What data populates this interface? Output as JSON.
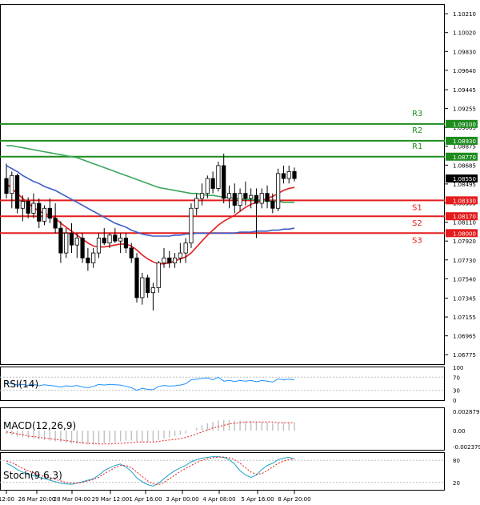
{
  "chart_data": {
    "type": "candlestick",
    "instrument_note": "",
    "price_axis": {
      "ticks": [
        "1.10210",
        "1.10020",
        "1.09830",
        "1.09640",
        "1.09445",
        "1.09255",
        "1.09065",
        "1.08875",
        "1.08685",
        "1.08495",
        "1.08305",
        "1.08110",
        "1.07920",
        "1.07730",
        "1.07540",
        "1.07345",
        "1.07155",
        "1.06965",
        "1.06775"
      ]
    },
    "price_range": [
      1.0668,
      1.103
    ],
    "time_axis": {
      "labels": [
        "12:00",
        "26 Mar 20:00",
        "28 Mar 04:00",
        "29 Mar 12:00",
        "1 Apr 16:00",
        "3 Apr 00:00",
        "4 Apr 08:00",
        "5 Apr 16:00",
        "8 Apr 20:00"
      ]
    },
    "current_price": "1.08550",
    "levels": [
      {
        "name": "R3",
        "value": 1.091,
        "label": "1.09100",
        "color": "#1e8c1e"
      },
      {
        "name": "R2",
        "value": 1.0893,
        "label": "1.08930",
        "color": "#1e8c1e"
      },
      {
        "name": "R1",
        "value": 1.0877,
        "label": "1.08770",
        "color": "#1e8c1e"
      },
      {
        "name": "S1",
        "value": 1.0833,
        "label": "1.08330",
        "color": "#e41c1c"
      },
      {
        "name": "S2",
        "value": 1.0817,
        "label": "1.08170",
        "color": "#e41c1c"
      },
      {
        "name": "S3",
        "value": 1.08,
        "label": "1.08000",
        "color": "#e41c1c"
      }
    ],
    "candles": [
      [
        1.0855,
        1.087,
        1.0835,
        1.084
      ],
      [
        1.084,
        1.0862,
        1.0825,
        1.0858
      ],
      [
        1.0858,
        1.086,
        1.082,
        1.0825
      ],
      [
        1.0825,
        1.0838,
        1.0812,
        1.0832
      ],
      [
        1.0832,
        1.0836,
        1.0815,
        1.082
      ],
      [
        1.082,
        1.084,
        1.0815,
        1.083
      ],
      [
        1.083,
        1.0835,
        1.0805,
        1.0812
      ],
      [
        1.0812,
        1.0828,
        1.0808,
        1.0825
      ],
      [
        1.0825,
        1.0835,
        1.081,
        1.0815
      ],
      [
        1.0815,
        1.083,
        1.08,
        1.0805
      ],
      [
        1.0805,
        1.0812,
        1.077,
        1.078
      ],
      [
        1.078,
        1.0805,
        1.0775,
        1.08
      ],
      [
        1.08,
        1.081,
        1.078,
        1.0788
      ],
      [
        1.0788,
        1.08,
        1.0775,
        1.0795
      ],
      [
        1.0795,
        1.08,
        1.077,
        1.0775
      ],
      [
        1.0775,
        1.0785,
        1.0762,
        1.077
      ],
      [
        1.077,
        1.0785,
        1.0765,
        1.078
      ],
      [
        1.078,
        1.08,
        1.0775,
        1.0795
      ],
      [
        1.0795,
        1.0805,
        1.0788,
        1.079
      ],
      [
        1.079,
        1.08,
        1.0785,
        1.0798
      ],
      [
        1.0798,
        1.0805,
        1.079,
        1.0792
      ],
      [
        1.0792,
        1.08,
        1.078,
        1.0795
      ],
      [
        1.0795,
        1.08,
        1.078,
        1.0785
      ],
      [
        1.0785,
        1.079,
        1.077,
        1.0775
      ],
      [
        1.0775,
        1.078,
        1.073,
        1.0735
      ],
      [
        1.0735,
        1.076,
        1.0728,
        1.0755
      ],
      [
        1.0755,
        1.0758,
        1.0735,
        1.074
      ],
      [
        1.074,
        1.075,
        1.0722,
        1.0745
      ],
      [
        1.0745,
        1.0772,
        1.074,
        1.077
      ],
      [
        1.077,
        1.0785,
        1.0765,
        1.0775
      ],
      [
        1.0775,
        1.0782,
        1.0765,
        1.077
      ],
      [
        1.077,
        1.078,
        1.0765,
        1.0775
      ],
      [
        1.0775,
        1.079,
        1.077,
        1.078
      ],
      [
        1.078,
        1.0795,
        1.077,
        1.079
      ],
      [
        1.079,
        1.083,
        1.0785,
        1.0825
      ],
      [
        1.0825,
        1.084,
        1.0818,
        1.0835
      ],
      [
        1.0835,
        1.085,
        1.0828,
        1.084
      ],
      [
        1.084,
        1.0858,
        1.0835,
        1.0855
      ],
      [
        1.0855,
        1.0862,
        1.084,
        1.0845
      ],
      [
        1.0845,
        1.0872,
        1.0842,
        1.0868
      ],
      [
        1.0868,
        1.088,
        1.083,
        1.0835
      ],
      [
        1.0835,
        1.0848,
        1.0825,
        1.084
      ],
      [
        1.084,
        1.085,
        1.082,
        1.0828
      ],
      [
        1.0828,
        1.0845,
        1.0822,
        1.084
      ],
      [
        1.084,
        1.0852,
        1.0828,
        1.0835
      ],
      [
        1.0835,
        1.0845,
        1.0825,
        1.0838
      ],
      [
        1.0838,
        1.0845,
        1.0795,
        1.083
      ],
      [
        1.083,
        1.0845,
        1.0825,
        1.084
      ],
      [
        1.084,
        1.0848,
        1.0825,
        1.0832
      ],
      [
        1.0832,
        1.084,
        1.082,
        1.0825
      ],
      [
        1.0825,
        1.0865,
        1.0822,
        1.086
      ],
      [
        1.086,
        1.0868,
        1.085,
        1.0855
      ],
      [
        1.0855,
        1.0868,
        1.085,
        1.0862
      ],
      [
        1.0862,
        1.0866,
        1.0852,
        1.0855
      ]
    ],
    "ma_red": [
      1.085,
      1.0845,
      1.084,
      1.0835,
      1.083,
      1.0826,
      1.0822,
      1.082,
      1.0818,
      1.0815,
      1.081,
      1.0806,
      1.0802,
      1.0798,
      1.0794,
      1.079,
      1.0787,
      1.0786,
      1.0786,
      1.0787,
      1.0788,
      1.0789,
      1.0789,
      1.0787,
      1.0783,
      1.0778,
      1.0774,
      1.0771,
      1.0769,
      1.0769,
      1.077,
      1.0772,
      1.0774,
      1.0776,
      1.078,
      1.0786,
      1.0792,
      1.0798,
      1.0803,
      1.0808,
      1.0812,
      1.0815,
      1.0818,
      1.0822,
      1.0826,
      1.0829,
      1.0831,
      1.0833,
      1.0835,
      1.0837,
      1.084,
      1.0843,
      1.0845,
      1.0846
    ],
    "ma_blue": [
      1.0868,
      1.0865,
      1.0862,
      1.0858,
      1.0855,
      1.0852,
      1.085,
      1.0847,
      1.0845,
      1.0843,
      1.084,
      1.0837,
      1.0834,
      1.0831,
      1.0828,
      1.0825,
      1.0822,
      1.0819,
      1.0816,
      1.0813,
      1.081,
      1.0808,
      1.0806,
      1.0803,
      1.0801,
      1.0799,
      1.0798,
      1.0797,
      1.0797,
      1.0797,
      1.0797,
      1.0798,
      1.0798,
      1.0799,
      1.0799,
      1.08,
      1.08,
      1.08,
      1.08,
      1.08,
      1.08,
      1.08,
      1.08,
      1.0801,
      1.0801,
      1.0801,
      1.0802,
      1.0802,
      1.0802,
      1.0803,
      1.0803,
      1.0804,
      1.0804,
      1.0805
    ],
    "ma_green": [
      1.0888,
      1.0888,
      1.0887,
      1.0886,
      1.0885,
      1.0884,
      1.0883,
      1.0882,
      1.0881,
      1.088,
      1.0879,
      1.0878,
      1.0877,
      1.0876,
      1.0874,
      1.0872,
      1.087,
      1.0868,
      1.0866,
      1.0864,
      1.0862,
      1.086,
      1.0858,
      1.0856,
      1.0854,
      1.0852,
      1.085,
      1.0848,
      1.0846,
      1.0845,
      1.0844,
      1.0843,
      1.0842,
      1.0841,
      1.084,
      1.084,
      1.0839,
      1.0838,
      1.0838,
      1.0837,
      1.0836,
      1.0836,
      1.0835,
      1.0835,
      1.0834,
      1.0834,
      1.0833,
      1.0833,
      1.0832,
      1.0832,
      1.0832,
      1.0831,
      1.0831,
      1.0831
    ],
    "rsi": {
      "label": "RSI(14)",
      "ticks": [
        "100",
        "70",
        "30",
        "0"
      ],
      "values": [
        52,
        50,
        46,
        48,
        45,
        49,
        44,
        47,
        45,
        43,
        40,
        44,
        42,
        45,
        40,
        38,
        42,
        48,
        46,
        48,
        47,
        46,
        42,
        38,
        30,
        36,
        33,
        32,
        42,
        45,
        43,
        44,
        46,
        50,
        62,
        64,
        66,
        68,
        62,
        70,
        58,
        60,
        57,
        60,
        58,
        60,
        56,
        60,
        58,
        55,
        65,
        62,
        64,
        62
      ]
    },
    "macd": {
      "label": "MACD(12,26,9)",
      "ticks": [
        "0.002879",
        "0.00",
        "-0.002379"
      ],
      "hist": [
        -0.0005,
        -0.0007,
        -0.0009,
        -0.001,
        -0.0011,
        -0.0012,
        -0.0013,
        -0.0014,
        -0.0015,
        -0.0016,
        -0.0017,
        -0.0018,
        -0.0019,
        -0.002,
        -0.002,
        -0.0021,
        -0.0021,
        -0.002,
        -0.0019,
        -0.0018,
        -0.0017,
        -0.0016,
        -0.0015,
        -0.0015,
        -0.0016,
        -0.0017,
        -0.0017,
        -0.0016,
        -0.0014,
        -0.0012,
        -0.001,
        -0.0008,
        -0.0006,
        -0.0004,
        0.0,
        0.0004,
        0.0008,
        0.0011,
        0.0013,
        0.0015,
        0.0016,
        0.0016,
        0.0015,
        0.0015,
        0.0014,
        0.0014,
        0.0013,
        0.0013,
        0.0012,
        0.0011,
        0.0012,
        0.0012,
        0.0012,
        0.0012
      ],
      "signal": [
        -0.0002,
        -0.0003,
        -0.0005,
        -0.0006,
        -0.0008,
        -0.0009,
        -0.001,
        -0.0011,
        -0.0012,
        -0.0013,
        -0.0014,
        -0.0015,
        -0.0016,
        -0.0017,
        -0.0018,
        -0.0019,
        -0.0019,
        -0.002,
        -0.002,
        -0.002,
        -0.0019,
        -0.0019,
        -0.0018,
        -0.0018,
        -0.0017,
        -0.0017,
        -0.0017,
        -0.0017,
        -0.0016,
        -0.0015,
        -0.0014,
        -0.0013,
        -0.0012,
        -0.001,
        -0.0008,
        -0.0005,
        -0.0002,
        0.0001,
        0.0004,
        0.0006,
        0.0008,
        0.001,
        0.0011,
        0.0012,
        0.0013,
        0.0013,
        0.0013,
        0.0013,
        0.0013,
        0.0013,
        0.0012,
        0.0012,
        0.0012,
        0.0012
      ]
    },
    "stoch": {
      "label": "Stoch(9,6,3)",
      "ticks": [
        "80",
        "20"
      ],
      "main": [
        72,
        65,
        55,
        48,
        42,
        38,
        34,
        30,
        26,
        22,
        18,
        16,
        15,
        18,
        22,
        26,
        30,
        40,
        52,
        60,
        66,
        70,
        62,
        50,
        32,
        22,
        14,
        10,
        18,
        30,
        42,
        52,
        60,
        66,
        76,
        82,
        86,
        88,
        90,
        90,
        88,
        82,
        70,
        52,
        40,
        34,
        40,
        55,
        66,
        72,
        82,
        86,
        88,
        84
      ],
      "signal": [
        78,
        74,
        66,
        58,
        52,
        46,
        40,
        36,
        32,
        28,
        24,
        20,
        18,
        18,
        20,
        24,
        28,
        34,
        44,
        52,
        60,
        66,
        66,
        60,
        48,
        36,
        24,
        16,
        14,
        20,
        30,
        40,
        50,
        58,
        66,
        74,
        80,
        84,
        87,
        89,
        89,
        87,
        82,
        72,
        60,
        48,
        42,
        44,
        52,
        62,
        72,
        78,
        82,
        84
      ]
    }
  }
}
